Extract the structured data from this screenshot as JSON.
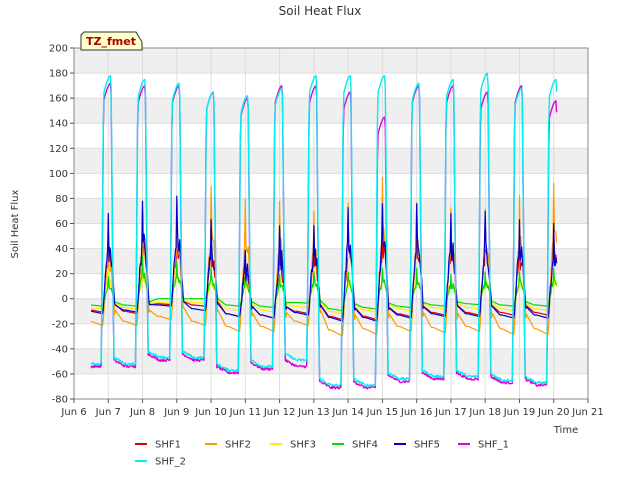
{
  "chart_data": {
    "type": "line",
    "title": "Soil Heat Flux",
    "xlabel": "Time",
    "ylabel": "Soil Heat Flux",
    "badge": "TZ_fmet",
    "xlim": [
      6,
      21
    ],
    "ylim": [
      -80,
      200
    ],
    "x_ticks": [
      6,
      7,
      8,
      9,
      10,
      11,
      12,
      13,
      14,
      15,
      16,
      17,
      18,
      19,
      20,
      21
    ],
    "x_tick_labels": [
      "Jun 6",
      "Jun 7",
      "Jun 8",
      "Jun 9",
      "Jun 10",
      "Jun 11",
      "Jun 12",
      "Jun 13",
      "Jun 14",
      "Jun 15",
      "Jun 16",
      "Jun 17",
      "Jun 18",
      "Jun 19",
      "Jun 20",
      "Jun 21"
    ],
    "y_ticks": [
      -80,
      -60,
      -40,
      -20,
      0,
      20,
      40,
      60,
      80,
      100,
      120,
      140,
      160,
      180,
      200
    ],
    "grid": true,
    "legend_position": "bottom",
    "days": [
      6,
      7,
      8,
      9,
      10,
      11,
      12,
      13,
      14,
      15,
      16,
      17,
      18,
      19
    ],
    "series": [
      {
        "name": "SHF1",
        "color": "#dd0000",
        "kind": "small",
        "night": [
          -9,
          -10,
          -4,
          -5,
          -12,
          -13,
          -10,
          -14,
          -14,
          -12,
          -11,
          -11,
          -11,
          -11
        ],
        "peak": [
          60,
          70,
          65,
          60,
          35,
          40,
          55,
          65,
          70,
          70,
          65,
          68,
          55,
          60
        ],
        "noise": 8
      },
      {
        "name": "SHF2",
        "color": "#ff9900",
        "kind": "small",
        "night": [
          -18,
          -18,
          -14,
          -18,
          -22,
          -22,
          -18,
          -25,
          -24,
          -22,
          -23,
          -22,
          -24,
          -24
        ],
        "peak": [
          50,
          72,
          73,
          92,
          82,
          80,
          72,
          79,
          100,
          79,
          75,
          74,
          85,
          95
        ],
        "noise": 6
      },
      {
        "name": "SHF3",
        "color": "#ffee00",
        "kind": "small",
        "night": [
          -7,
          -7,
          -3,
          -3,
          -8,
          -9,
          -6,
          -10,
          -9,
          -8,
          -7,
          -7,
          -8,
          -8
        ],
        "peak": [
          25,
          30,
          30,
          20,
          20,
          22,
          25,
          22,
          25,
          25,
          20,
          22,
          22,
          25
        ],
        "noise": 3
      },
      {
        "name": "SHF4",
        "color": "#00dd00",
        "kind": "small",
        "night": [
          -5,
          -5,
          0,
          0,
          -5,
          -6,
          -3,
          -8,
          -7,
          -6,
          -5,
          -4,
          -5,
          -5
        ],
        "peak": [
          18,
          35,
          30,
          25,
          20,
          20,
          22,
          22,
          25,
          25,
          20,
          22,
          22,
          25
        ],
        "noise": 3
      },
      {
        "name": "SHF5",
        "color": "#0000cc",
        "kind": "small",
        "night": [
          -10,
          -9,
          -5,
          -8,
          -12,
          -13,
          -11,
          -15,
          -15,
          -13,
          -12,
          -12,
          -13,
          -13
        ],
        "peak": [
          70,
          80,
          84,
          65,
          40,
          60,
          60,
          75,
          78,
          78,
          70,
          72,
          65,
          62
        ],
        "noise": 10
      },
      {
        "name": "SHF_1",
        "color": "#dd00dd",
        "kind": "big",
        "night": [
          -55,
          -55,
          -50,
          -50,
          -60,
          -57,
          -55,
          -72,
          -72,
          -67,
          -65,
          -65,
          -68,
          -70
        ],
        "peak": [
          172,
          170,
          170,
          165,
          160,
          170,
          170,
          165,
          145,
          170,
          170,
          165,
          170,
          158
        ],
        "noise": 3
      },
      {
        "name": "SHF_2",
        "color": "#00eeee",
        "kind": "big",
        "night": [
          -53,
          -53,
          -48,
          -48,
          -58,
          -55,
          -50,
          -70,
          -70,
          -65,
          -63,
          -63,
          -66,
          -68
        ],
        "peak": [
          178,
          175,
          172,
          165,
          162,
          168,
          178,
          178,
          178,
          172,
          175,
          180,
          168,
          175
        ],
        "noise": 3
      }
    ]
  }
}
